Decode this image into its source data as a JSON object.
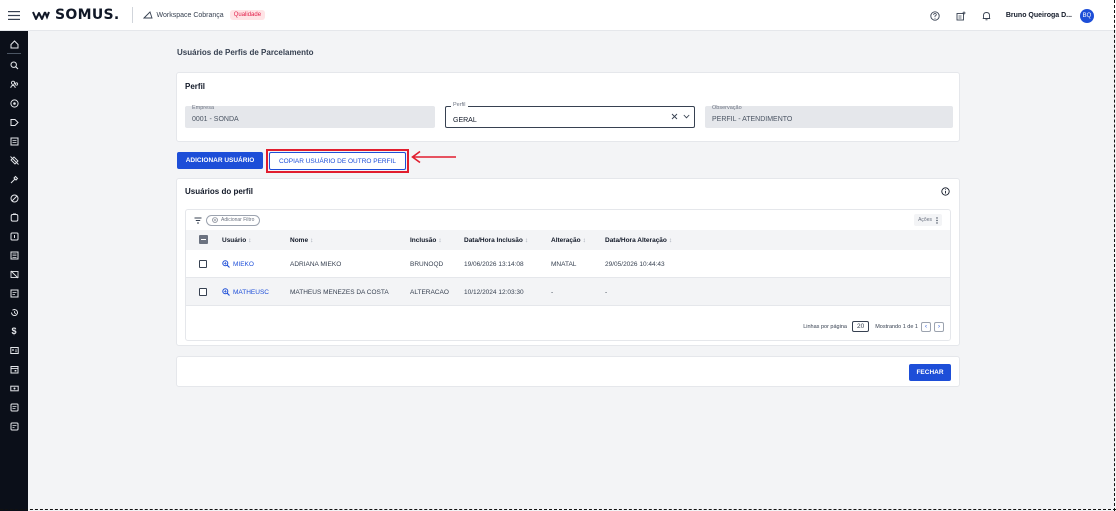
{
  "header": {
    "logo_text": "SOMUS.",
    "workspace_label": "Workspace Cobrança",
    "env_badge": "Qualidade",
    "user_name": "Bruno Queiroga D...",
    "avatar_initials": "BQ"
  },
  "sidebar": {
    "icons": [
      "home-icon",
      "search-icon",
      "users-icon",
      "settings-icon",
      "forward-icon",
      "document-icon",
      "tag-off-icon",
      "tools-icon",
      "block-icon",
      "clipboard-icon",
      "square-bracket-icon",
      "list-icon",
      "image-off-icon",
      "report-icon",
      "history-icon",
      "dollar-icon",
      "id-card-icon",
      "calendar-icon",
      "cash-icon",
      "file-text-icon",
      "file-check-icon"
    ]
  },
  "page": {
    "title": "Usuários de Perfis de Parcelamento"
  },
  "perfil_card": {
    "title": "Perfil",
    "empresa_label": "Empresa",
    "empresa_value": "0001 - SONDA",
    "perfil_label": "Perfil",
    "perfil_value": "GERAL",
    "observacao_label": "Observação",
    "observacao_value": "PERFIL - ATENDIMENTO"
  },
  "actions": {
    "add_user": "Adicionar Usuário",
    "copy_user": "Copiar usuário de outro perfil"
  },
  "users_card": {
    "title": "Usuários do perfil",
    "add_filter": "Adicionar Filtro",
    "actions_label": "Ações",
    "columns": [
      "Usuário",
      "Nome",
      "Inclusão",
      "Data/Hora Inclusão",
      "Alteração",
      "Data/Hora Alteração"
    ],
    "rows": [
      {
        "usuario": "MIEKO",
        "nome": "ADRIANA MIEKO",
        "inclusao": "BRUNOQD",
        "data_inclusao": "19/06/2026 13:14:08",
        "alteracao": "MNATAL",
        "data_alteracao": "29/05/2026 10:44:43"
      },
      {
        "usuario": "MATHEUSC",
        "nome": "MATHEUS MENEZES DA COSTA",
        "inclusao": "ALTERACAO",
        "data_inclusao": "10/12/2024 12:03:30",
        "alteracao": "-",
        "data_alteracao": "-"
      }
    ],
    "pager": {
      "rows_per_page_label": "Linhas por página",
      "rows_per_page": "20",
      "showing": "Mostrando 1 de 1"
    }
  },
  "footer": {
    "close": "Fechar"
  },
  "colors": {
    "primary": "#1d4ed8",
    "highlight": "#e11d2e",
    "sidebar_bg": "#0b0f19"
  }
}
